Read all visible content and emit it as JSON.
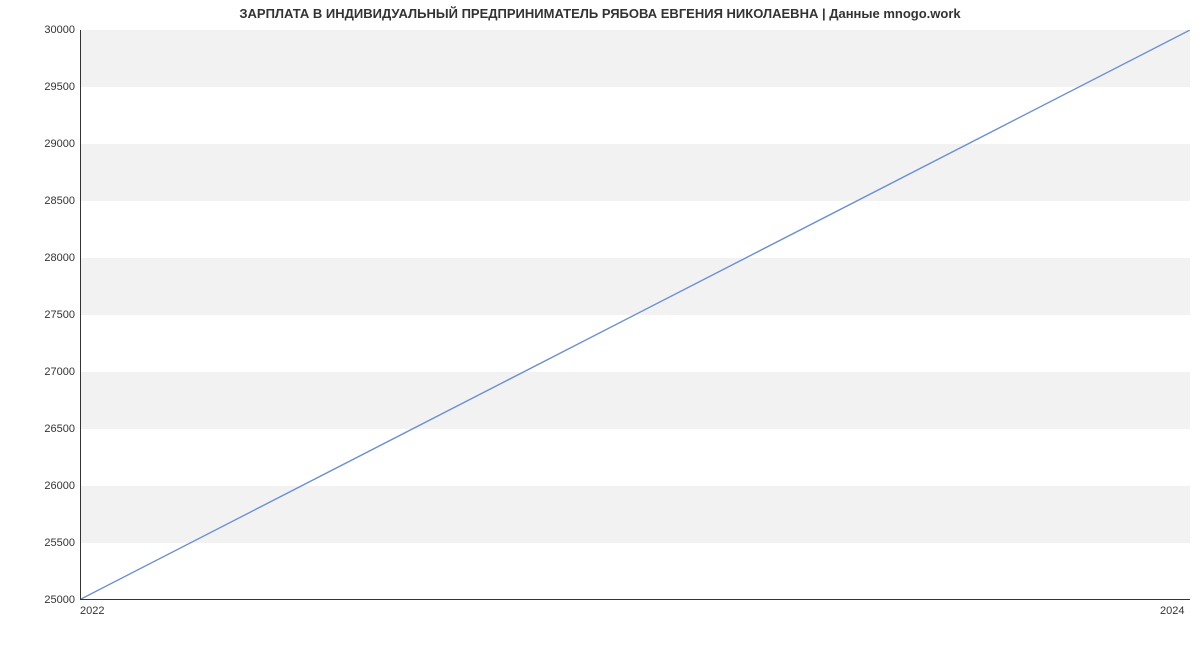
{
  "chart_data": {
    "type": "line",
    "title": "ЗАРПЛАТА В ИНДИВИДУАЛЬНЫЙ ПРЕДПРИНИМАТЕЛЬ РЯБОВА ЕВГЕНИЯ НИКОЛАЕВНА | Данные mnogo.work",
    "xlabel": "",
    "ylabel": "",
    "x": [
      2022,
      2024
    ],
    "values": [
      25000,
      30000
    ],
    "x_ticks": [
      2022,
      2024
    ],
    "y_ticks": [
      25000,
      25500,
      26000,
      26500,
      27000,
      27500,
      28000,
      28500,
      29000,
      29500,
      30000
    ],
    "xlim": [
      2022,
      2024
    ],
    "ylim": [
      25000,
      30000
    ],
    "line_color": "#6b8fd4",
    "band_color": "#f2f2f2"
  }
}
